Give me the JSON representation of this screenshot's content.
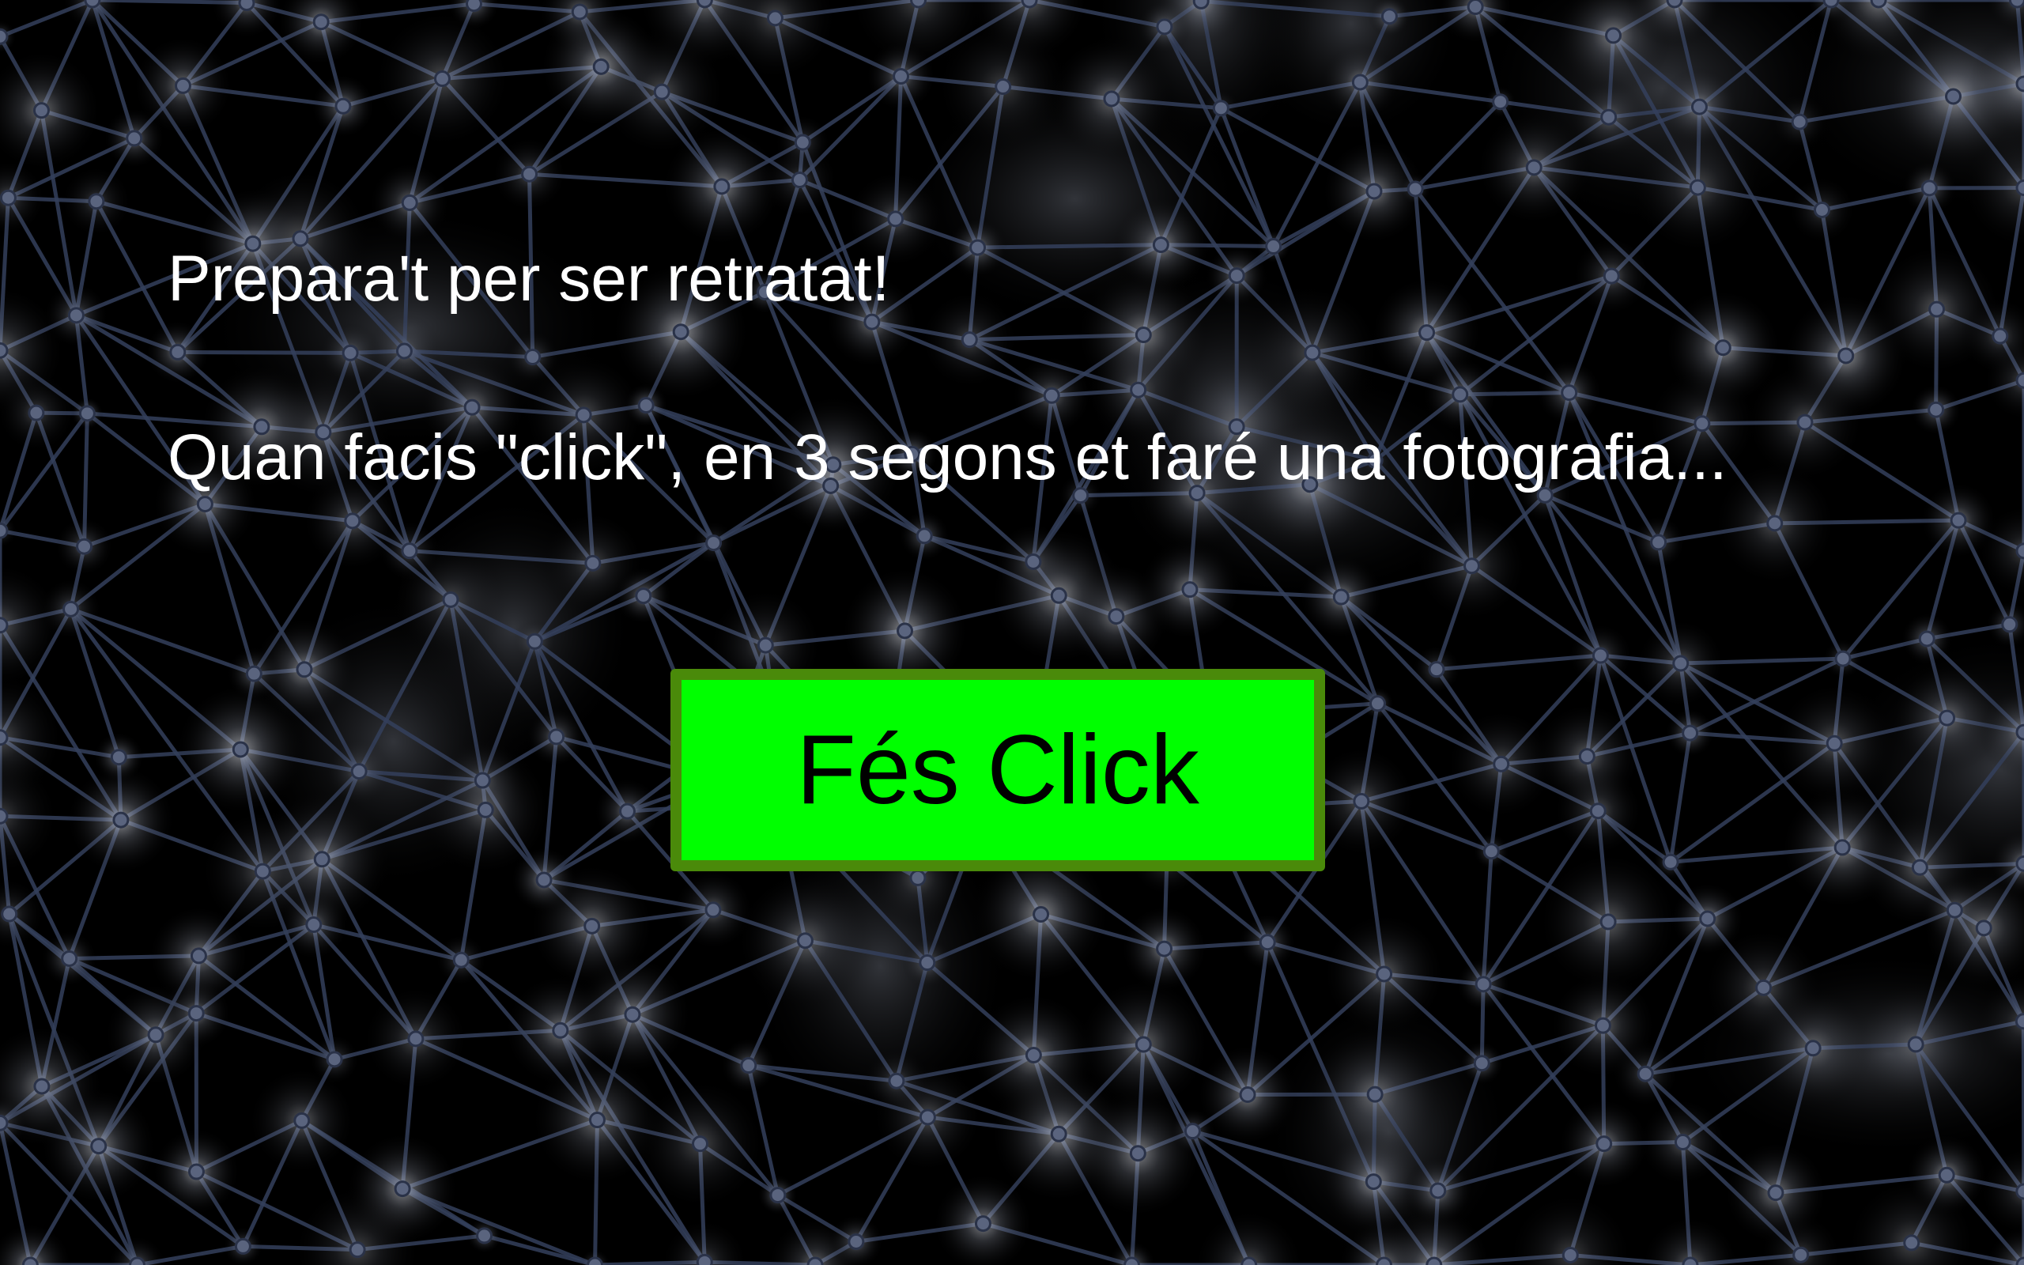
{
  "screen": {
    "heading": "Prepara't per ser retratat!",
    "instruction": "Quan facis \"click\", en 3 segons et faré una fotografia...",
    "button_label": "Fés Click"
  },
  "background": {
    "description_icon": "network-background",
    "color": "#000000",
    "line_color": "#3a4a6a",
    "glow_color": "#c8ccd6"
  },
  "button": {
    "fill_color": "#00ff00",
    "border_color": "#4a8a0a"
  }
}
